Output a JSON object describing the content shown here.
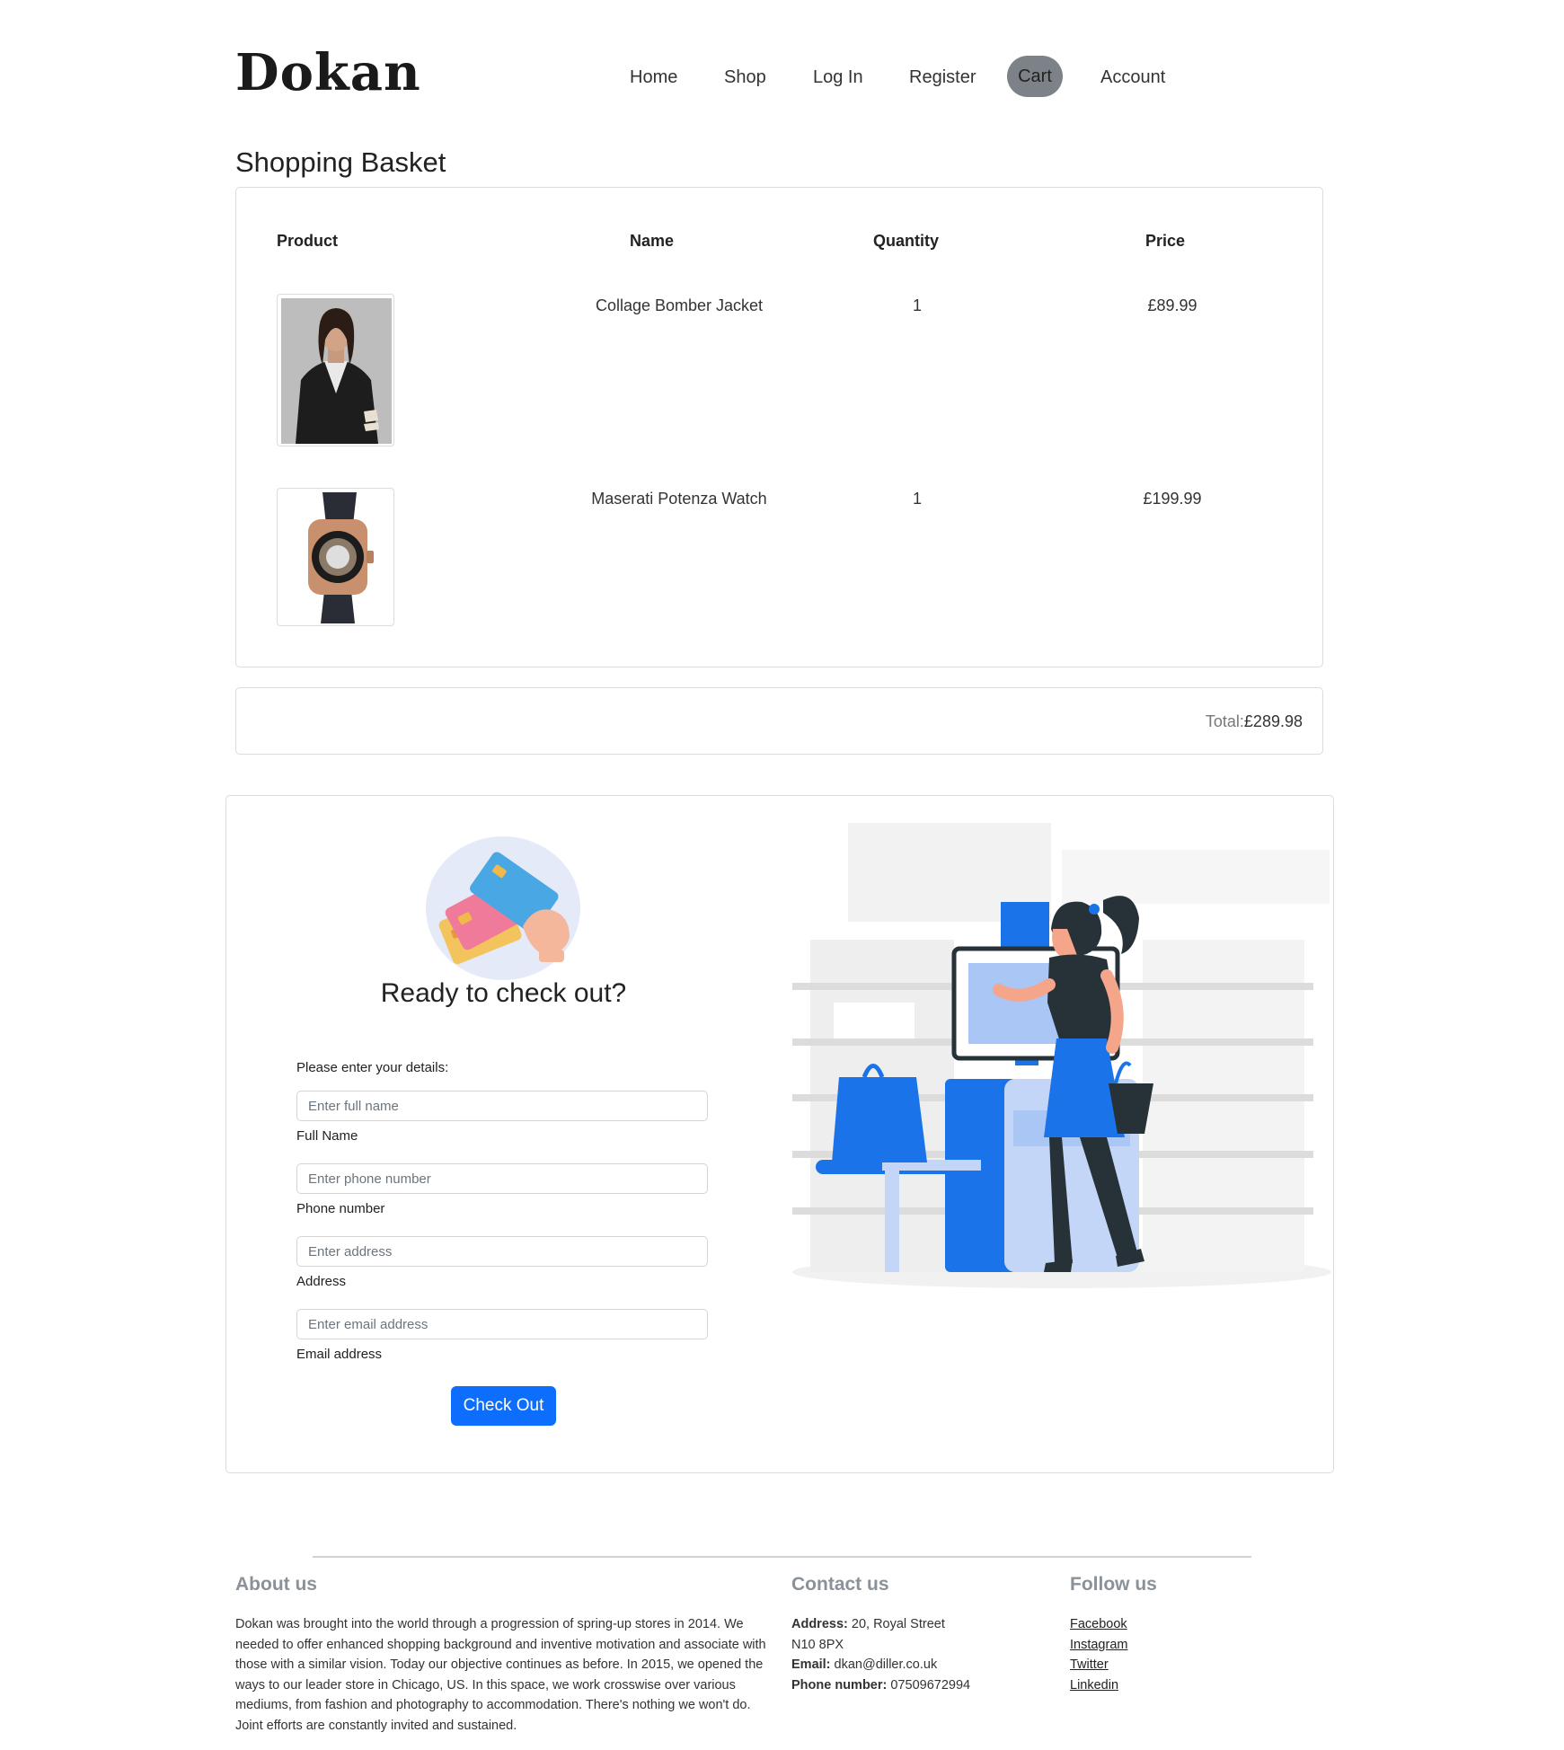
{
  "header": {
    "logo": "Dokan",
    "nav": [
      "Home",
      "Shop",
      "Log In",
      "Register",
      "Cart",
      "Account"
    ],
    "active_nav": "Cart"
  },
  "basket": {
    "title": "Shopping Basket",
    "columns": [
      "Product",
      "Name",
      "Quantity",
      "Price"
    ],
    "items": [
      {
        "name": "Collage Bomber Jacket",
        "quantity": "1",
        "price": "£89.99",
        "image": "jacket-photo"
      },
      {
        "name": "Maserati Potenza Watch",
        "quantity": "1",
        "price": "£199.99",
        "image": "watch-photo"
      }
    ],
    "total_label": "Total:",
    "total_value": "£289.98"
  },
  "checkout": {
    "title": "Ready to check out?",
    "intro": "Please enter your details:",
    "fields": [
      {
        "placeholder": "Enter full name",
        "label": "Full Name"
      },
      {
        "placeholder": "Enter phone number",
        "label": "Phone number"
      },
      {
        "placeholder": "Enter address",
        "label": "Address"
      },
      {
        "placeholder": "Enter email address",
        "label": "Email address"
      }
    ],
    "button": "Check Out",
    "colors": {
      "primary": "#0d6efd",
      "illustration_blue": "#1a73e8"
    }
  },
  "footer": {
    "about": {
      "title": "About us",
      "text": "Dokan was brought into the world through a progression of spring-up stores in 2014. We needed to offer enhanced shopping background and inventive motivation and associate with those with a similar vision. Today our objective continues as before. In 2015, we opened the ways to our leader store in Chicago, US. In this space, we work crosswise over various mediums, from fashion and photography to accommodation. There's nothing we won't do. Joint efforts are constantly invited and sustained."
    },
    "contact": {
      "title": "Contact us",
      "address_label": "Address:",
      "address_line1": " 20, Royal Street",
      "address_line2": "N10 8PX",
      "email_label": "Email:",
      "email": " dkan@diller.co.uk",
      "phone_label": "Phone number:",
      "phone": " 07509672994"
    },
    "follow": {
      "title": "Follow us",
      "links": [
        "Facebook",
        "Instagram",
        "Twitter",
        "Linkedin"
      ]
    }
  }
}
